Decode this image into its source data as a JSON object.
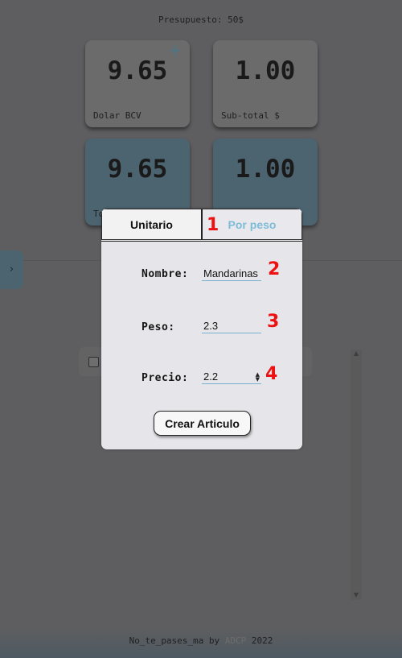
{
  "header": {
    "budget": "Presupuesto: 50$"
  },
  "cards": {
    "dolar": {
      "value": "9.65",
      "label": "Dolar BCV",
      "add_icon": "+"
    },
    "subtotal": {
      "value": "1.00",
      "label": "Sub-total $"
    },
    "total_bs": {
      "value": "9.65",
      "label_fragment": "To"
    },
    "total_usd": {
      "value": "1.00"
    }
  },
  "sidebar": {
    "toggle_icon": "›"
  },
  "modal": {
    "tabs": {
      "unitario": "Unitario",
      "por_peso": "Por peso",
      "active": "por_peso"
    },
    "fields": {
      "nombre": {
        "label": "Nombre:",
        "value": "Mandarinas"
      },
      "peso": {
        "label": "Peso:",
        "value": "2.3"
      },
      "precio": {
        "label": "Precio:",
        "value": "2.2",
        "spinner_up": "▲",
        "spinner_down": "▼"
      }
    },
    "create_button": "Crear Articulo",
    "annotations": [
      "1",
      "2",
      "3",
      "4"
    ]
  },
  "scrollbar": {
    "up": "▲",
    "down": "▼"
  },
  "footer": {
    "prefix": "No_te_pases_ma by ",
    "brand": "ADCP",
    "year": " 2022"
  },
  "colors": {
    "accent": "#7dbcd8",
    "annotation": "#ee1111",
    "teal_card": "#4c6470"
  }
}
